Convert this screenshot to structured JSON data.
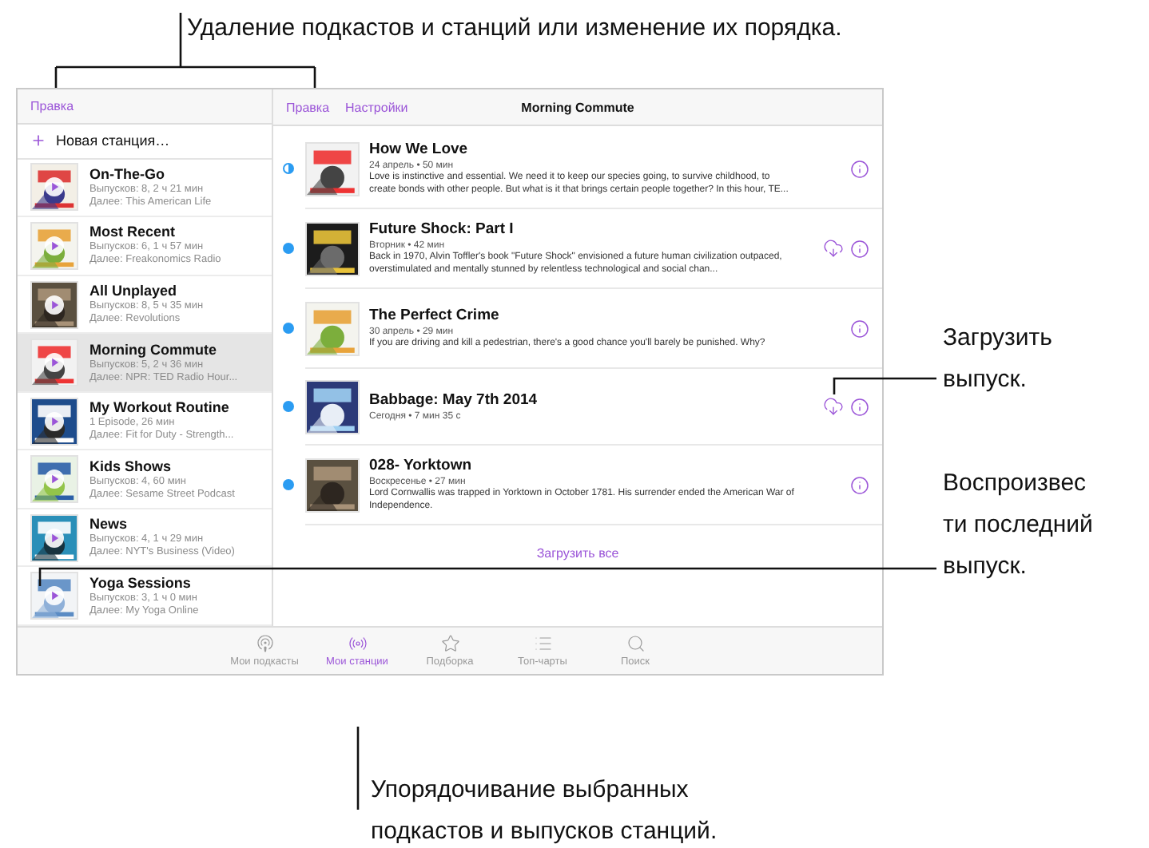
{
  "callouts": {
    "top": "Удаление подкастов и станций или изменение их порядка.",
    "download": [
      "Загрузить",
      "выпуск."
    ],
    "play": [
      "Воспроизвес",
      "ти последний",
      "выпуск."
    ],
    "bottom": [
      "Упорядочивание выбранных",
      "подкастов и выпусков станций."
    ]
  },
  "sidebar": {
    "edit": "Правка",
    "new_station": "Новая станция…",
    "stations": [
      {
        "title": "On-The-Go",
        "episodes": "Выпусков: 8, 2 ч 21 мин",
        "next": "Далее: This American Life",
        "selected": false
      },
      {
        "title": "Most Recent",
        "episodes": "Выпусков: 6, 1 ч 57 мин",
        "next": "Далее: Freakonomics Radio",
        "selected": false
      },
      {
        "title": "All Unplayed",
        "episodes": "Выпусков: 8, 5 ч 35 мин",
        "next": "Далее: Revolutions",
        "selected": false
      },
      {
        "title": "Morning Commute",
        "episodes": "Выпусков: 5, 2 ч 36 мин",
        "next": "Далее: NPR: TED Radio Hour...",
        "selected": true
      },
      {
        "title": "My Workout Routine",
        "episodes": "1 Episode, 26 мин",
        "next": "Далее: Fit for Duty - Strength...",
        "selected": false
      },
      {
        "title": "Kids Shows",
        "episodes": "Выпусков: 4, 60 мин",
        "next": "Далее: Sesame Street Podcast",
        "selected": false
      },
      {
        "title": "News",
        "episodes": "Выпусков: 4, 1 ч 29 мин",
        "next": "Далее: NYT's Business (Video)",
        "selected": false
      },
      {
        "title": "Yoga Sessions",
        "episodes": "Выпусков: 3, 1 ч 0 мин",
        "next": "Далее: My Yoga Online",
        "selected": false
      }
    ]
  },
  "detail": {
    "edit": "Правка",
    "settings": "Настройки",
    "title": "Morning Commute",
    "download_all": "Загрузить все",
    "episodes": [
      {
        "title": "How We Love",
        "date": "24 апрель • 50 мин",
        "description": "Love is instinctive and essential. We need it to keep our species going, to survive childhood, to create bonds with other people. But what is it that brings certain people together?  In this hour, TE...",
        "partly_played": true,
        "downloadable": false
      },
      {
        "title": "Future Shock: Part I",
        "date": "Вторник • 42 мин",
        "description": "Back in 1970, Alvin Toffler's book \"Future Shock\" envisioned a future human civilization outpaced, overstimulated and mentally stunned by relentless technological and social chan...",
        "partly_played": false,
        "downloadable": true
      },
      {
        "title": "The Perfect Crime",
        "date": "30 апрель • 29 мин",
        "description": "If you are driving and kill a pedestrian, there's a good chance you'll barely be punished. Why?",
        "partly_played": false,
        "downloadable": false
      },
      {
        "title": "Babbage: May 7th 2014",
        "date": "Сегодня • 7 мин 35 с",
        "partly_played": false,
        "downloadable": true
      },
      {
        "title": "028- Yorktown",
        "date": "Воскресенье • 27 мин",
        "description": "Lord Cornwallis was trapped in Yorktown in October 1781. His surrender ended the American War of Independence.",
        "partly_played": false,
        "downloadable": false
      }
    ]
  },
  "tab_bar": [
    {
      "label": "Мои подкасты",
      "kind": "podcasts",
      "selected": false
    },
    {
      "label": "Мои станции",
      "kind": "stations",
      "selected": true
    },
    {
      "label": "Подборка",
      "kind": "featured",
      "selected": false
    },
    {
      "label": "Топ-чарты",
      "kind": "charts",
      "selected": false
    },
    {
      "label": "Поиск",
      "kind": "search",
      "selected": false
    }
  ]
}
